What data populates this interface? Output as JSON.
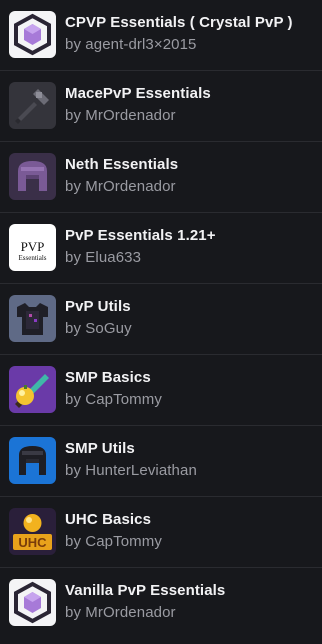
{
  "packs": [
    {
      "icon": "crystal-hexagon-icon",
      "title": "CPVP Essentials ( Crystal PvP )",
      "author": "by agent-drl3×2015"
    },
    {
      "icon": "mace-icon",
      "title": "MacePvP Essentials",
      "author": "by MrOrdenador"
    },
    {
      "icon": "netherite-helmet-icon",
      "title": "Neth Essentials",
      "author": "by MrOrdenador"
    },
    {
      "icon": "pvp-essentials-logo-icon",
      "title": "PvP Essentials 1.21+",
      "author": "by Elua633",
      "logo_text": [
        "PVP",
        "Essentials"
      ]
    },
    {
      "icon": "chestplate-icon",
      "title": "PvP Utils",
      "author": "by SoGuy"
    },
    {
      "icon": "golden-apple-sword-icon",
      "title": "SMP Basics",
      "author": "by CapTommy"
    },
    {
      "icon": "dark-helmet-icon",
      "title": "SMP Utils",
      "author": "by HunterLeviathan"
    },
    {
      "icon": "uhc-logo-icon",
      "title": "UHC Basics",
      "author": "by CapTommy",
      "logo_text": "UHC"
    },
    {
      "icon": "crystal-hexagon-icon",
      "title": "Vanilla PvP Essentials",
      "author": "by MrOrdenador"
    }
  ],
  "colors": {
    "background": "#17181c",
    "title": "#f2f2f4",
    "author": "#9a9ba2",
    "divider": "#2a2b30"
  }
}
